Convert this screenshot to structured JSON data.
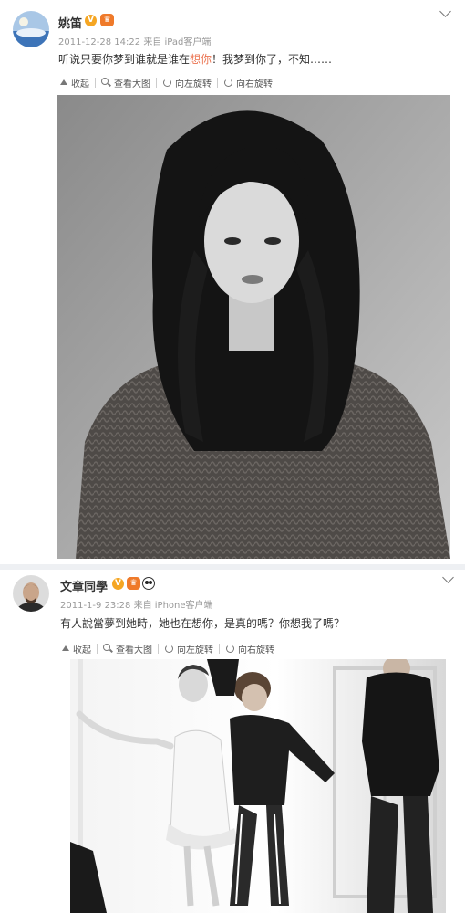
{
  "posts": [
    {
      "username": "姚笛",
      "verified_badge": "V",
      "meta": {
        "date": "2011-12-28 14:22",
        "from": "来自",
        "source": "iPad客户端"
      },
      "content": {
        "before": "听说只要你梦到谁就是谁在",
        "highlight": "想你",
        "after": "！我梦到你了，不知……"
      },
      "toolbar": {
        "collapse": "收起",
        "view_large": "查看大图",
        "rotate_left": "向左旋转",
        "rotate_right": "向右旋转"
      },
      "photo": {
        "subject": "woman-portrait-bw"
      }
    },
    {
      "username": "文章同學",
      "verified_badge": "V",
      "meta": {
        "date": "2011-1-9 23:28",
        "from": "来自",
        "source": "iPhone客户端"
      },
      "content": {
        "text": "有人說當夢到她時，她也在想你，是真的嗎？你想我了嗎？"
      },
      "toolbar": {
        "collapse": "收起",
        "view_large": "查看大图",
        "rotate_left": "向左旋转",
        "rotate_right": "向右旋转"
      },
      "photo": {
        "subject": "fashion-shoot-bw"
      }
    }
  ],
  "colors": {
    "highlight": "#eb7350",
    "meta": "#999999",
    "badge": "#f5a623",
    "crown": "#ef7a2a"
  },
  "icons": [
    "avatar",
    "verified-badge",
    "crown-icon",
    "panda-icon",
    "chevron-down-icon",
    "collapse-icon",
    "zoom-icon",
    "rotate-left-icon",
    "rotate-right-icon"
  ]
}
